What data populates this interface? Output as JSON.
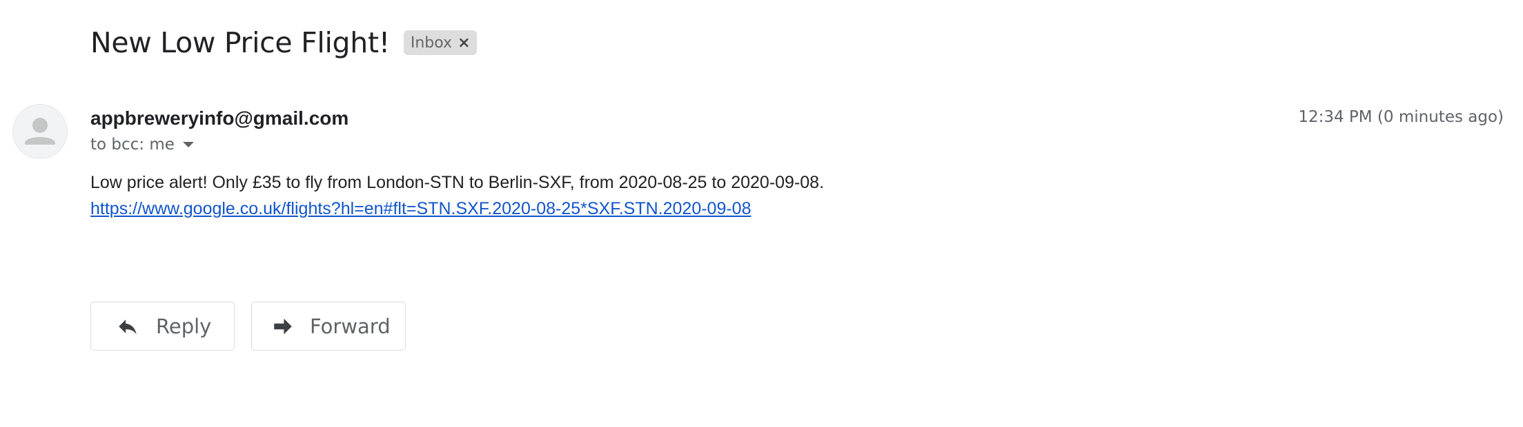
{
  "email": {
    "subject": "New Low Price Flight!",
    "label": "Inbox",
    "label_close": "×",
    "sender": "appbreweryinfo@gmail.com",
    "timestamp": "12:34 PM (0 minutes ago)",
    "recipients": "to bcc: me",
    "body_text": "Low price alert! Only £35 to fly from London-STN to Berlin-SXF, from 2020-08-25 to 2020-09-08.",
    "body_link": "https://www.google.co.uk/flights?hl=en#flt=STN.SXF.2020-08-25*SXF.STN.2020-09-08"
  },
  "actions": {
    "reply_label": "Reply",
    "forward_label": "Forward"
  },
  "icons": {
    "avatar": "person-icon",
    "reply": "reply-icon",
    "forward": "forward-icon",
    "recipients_caret": "chevron-down-icon"
  },
  "colors": {
    "link": "#1155cc",
    "label_chip": "#dddddd",
    "secondary_text": "#5f6368"
  }
}
